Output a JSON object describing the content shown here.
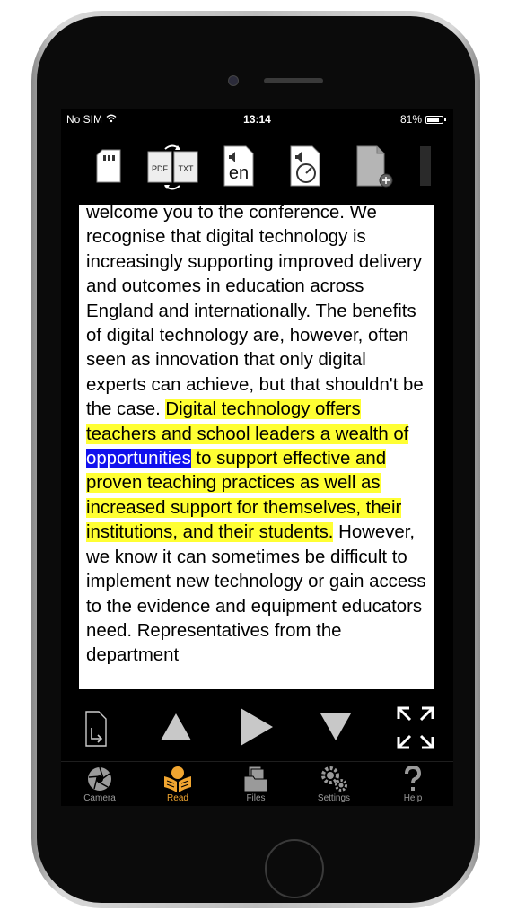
{
  "status_bar": {
    "carrier": "No SIM",
    "time": "13:14",
    "battery_text": "81%",
    "battery_level": 0.81
  },
  "toolbar": {
    "items": [
      {
        "name": "sd-card-icon"
      },
      {
        "name": "pdf-txt-convert-icon",
        "pdf_label": "PDF",
        "txt_label": "TXT"
      },
      {
        "name": "language-icon",
        "label": "en"
      },
      {
        "name": "speech-speed-icon"
      },
      {
        "name": "add-document-icon"
      }
    ]
  },
  "reader": {
    "before": "welcome you to the conference. We recognise that digital technology is increasingly supporting improved delivery and outcomes in education across England and internationally. The benefits of digital technology are, however, often seen as innovation that only digital experts can achieve, but that shouldn't be the case. ",
    "highlight_before": "Digital technology offers teachers and school leaders a wealth of ",
    "current_word": "opportunities",
    "highlight_after": " to support effective and proven teaching practices as well as increased support for themselves, their institutions, and their students.",
    "after": " However, we know it can sometimes be difficult to implement new technology or gain access to the evidence and equipment educators need. Representatives from the department"
  },
  "colors": {
    "highlight": "#ffff33",
    "current_word": "#1010ee",
    "active_tab": "#f0a530",
    "inactive_tab": "#9a9a9a"
  },
  "tabs": [
    {
      "label": "Camera",
      "icon": "camera-aperture-icon",
      "active": false
    },
    {
      "label": "Read",
      "icon": "reading-person-icon",
      "active": true
    },
    {
      "label": "Files",
      "icon": "files-folder-icon",
      "active": false
    },
    {
      "label": "Settings",
      "icon": "gears-icon",
      "active": false
    },
    {
      "label": "Help",
      "icon": "question-mark-icon",
      "active": false
    }
  ]
}
